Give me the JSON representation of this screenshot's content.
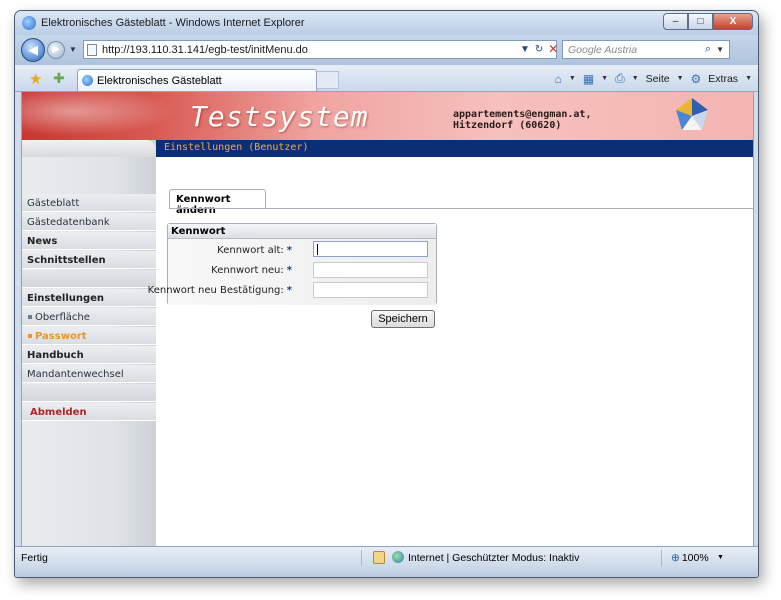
{
  "window": {
    "title": "Elektronisches Gästeblatt - Windows Internet Explorer",
    "minimize": "–",
    "maximize": "□",
    "close": "X"
  },
  "address": {
    "url": "http://193.110.31.141/egb-test/initMenu.do",
    "search_placeholder": "Google Austria",
    "refresh": "↻",
    "stop": "✕"
  },
  "tabs": {
    "active_label": "Elektronisches Gästeblatt"
  },
  "commandbar": {
    "page": "Seite",
    "extras": "Extras"
  },
  "banner": {
    "title": "Testsystem",
    "email_line1": "appartements@engman.at,",
    "email_line2": "Hitzendorf (60620)"
  },
  "subheader": "Einstellungen (Benutzer)",
  "sidebar": {
    "items": [
      {
        "label": "Gästeblatt"
      },
      {
        "label": "Gästedatenbank"
      },
      {
        "label": "News"
      },
      {
        "label": "Schnittstellen"
      },
      {
        "label": "Einstellungen"
      },
      {
        "label": "Oberfläche"
      },
      {
        "label": "Passwort"
      },
      {
        "label": "Handbuch"
      },
      {
        "label": "Mandantenwechsel"
      },
      {
        "label": "Abmelden"
      }
    ]
  },
  "content": {
    "tab_label": "Kennwort ändern",
    "panel_title": "Kennwort",
    "fields": [
      {
        "label": "Kennwort alt:",
        "value": ""
      },
      {
        "label": "Kennwort neu:",
        "value": ""
      },
      {
        "label": "Kennwort neu Bestätigung:",
        "value": ""
      }
    ],
    "required_marker": "*",
    "save_label": "Speichern"
  },
  "status": {
    "left": "Fertig",
    "zone": "Internet | Geschützter Modus: Inaktiv",
    "zoom": "100%"
  },
  "colors": {
    "nav_bar": "#0b2f77",
    "accent_orange": "#e8962b",
    "logout_red": "#b52323"
  }
}
